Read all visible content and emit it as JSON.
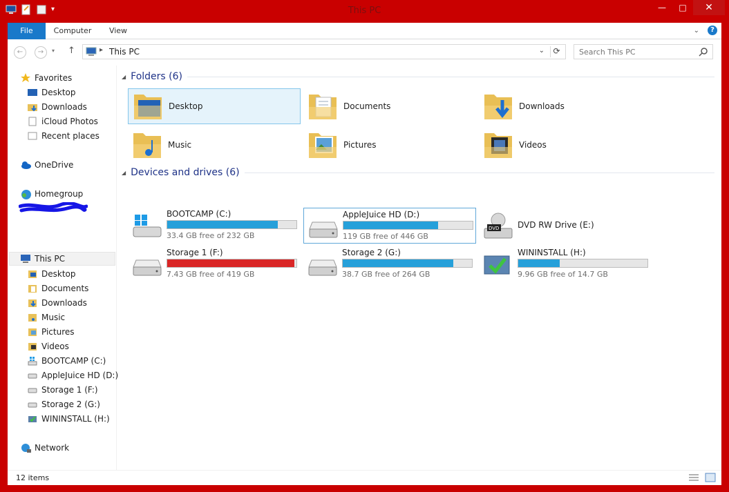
{
  "window": {
    "title": "This PC",
    "controls": {
      "minimize": "—",
      "maximize": "□",
      "close": "✕"
    },
    "frame_color": "#c90000"
  },
  "ribbon": {
    "tabs": [
      {
        "label": "File",
        "active": true
      },
      {
        "label": "Computer",
        "active": false
      },
      {
        "label": "View",
        "active": false
      }
    ],
    "accent": "#1979ca"
  },
  "address": {
    "location": "This PC",
    "icon": "computer-icon"
  },
  "search": {
    "placeholder": "Search This PC"
  },
  "navpane": {
    "favorites": {
      "label": "Favorites",
      "items": [
        {
          "label": "Desktop",
          "icon": "desktop-icon"
        },
        {
          "label": "Downloads",
          "icon": "downloads-folder-icon"
        },
        {
          "label": "iCloud Photos",
          "icon": "icloud-photos-icon"
        },
        {
          "label": "Recent places",
          "icon": "recent-places-icon"
        }
      ]
    },
    "onedrive": {
      "label": "OneDrive",
      "icon": "onedrive-icon"
    },
    "homegroup": {
      "label": "Homegroup",
      "icon": "homegroup-icon"
    },
    "thispc": {
      "label": "This PC",
      "items": [
        {
          "label": "Desktop",
          "icon": "folder-icon"
        },
        {
          "label": "Documents",
          "icon": "folder-icon"
        },
        {
          "label": "Downloads",
          "icon": "folder-icon"
        },
        {
          "label": "Music",
          "icon": "folder-icon"
        },
        {
          "label": "Pictures",
          "icon": "folder-icon"
        },
        {
          "label": "Videos",
          "icon": "folder-icon"
        },
        {
          "label": "BOOTCAMP (C:)",
          "icon": "windows-drive-icon"
        },
        {
          "label": "AppleJuice HD (D:)",
          "icon": "drive-icon"
        },
        {
          "label": "Storage 1 (F:)",
          "icon": "drive-icon"
        },
        {
          "label": "Storage 2 (G:)",
          "icon": "drive-icon"
        },
        {
          "label": "WININSTALL (H:)",
          "icon": "install-drive-icon"
        }
      ]
    },
    "network": {
      "label": "Network",
      "icon": "network-icon"
    }
  },
  "content": {
    "folders_heading": "Folders (6)",
    "folders": [
      {
        "label": "Desktop",
        "icon": "desktop-folder-icon",
        "selected": true
      },
      {
        "label": "Documents",
        "icon": "documents-folder-icon"
      },
      {
        "label": "Downloads",
        "icon": "downloads-folder-icon"
      },
      {
        "label": "Music",
        "icon": "music-folder-icon"
      },
      {
        "label": "Pictures",
        "icon": "pictures-folder-icon"
      },
      {
        "label": "Videos",
        "icon": "videos-folder-icon"
      }
    ],
    "drives_heading": "Devices and drives (6)",
    "drives": [
      {
        "label": "BOOTCAMP (C:)",
        "free": "33.4 GB free of 232 GB",
        "used_fraction": 0.856,
        "icon": "windows-drive-icon",
        "bar_color": "#26a0da"
      },
      {
        "label": "AppleJuice HD (D:)",
        "free": "119 GB free of 446 GB",
        "used_fraction": 0.733,
        "icon": "drive-icon",
        "bar_color": "#26a0da",
        "focused": true
      },
      {
        "label": "DVD RW Drive (E:)",
        "free": "",
        "used_fraction": null,
        "icon": "dvd-drive-icon"
      },
      {
        "label": "Storage 1 (F:)",
        "free": "7.43 GB free of 419 GB",
        "used_fraction": 0.982,
        "icon": "drive-icon",
        "bar_color": "#da2626"
      },
      {
        "label": "Storage 2 (G:)",
        "free": "38.7 GB free of 264 GB",
        "used_fraction": 0.853,
        "icon": "drive-icon",
        "bar_color": "#26a0da"
      },
      {
        "label": "WININSTALL (H:)",
        "free": "9.96 GB free of 14.7 GB",
        "used_fraction": 0.322,
        "icon": "install-drive-icon",
        "bar_color": "#26a0da"
      }
    ]
  },
  "status": {
    "count": "12 items"
  }
}
